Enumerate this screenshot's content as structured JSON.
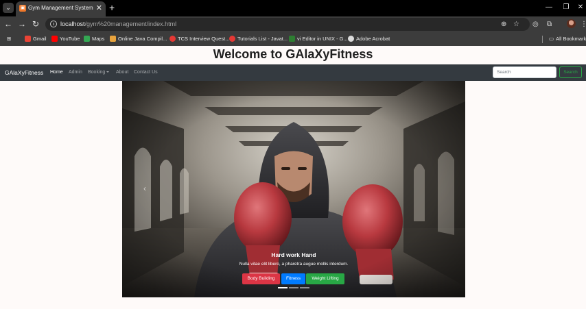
{
  "browser": {
    "tab_title": "Gym Management System",
    "url_host": "localhost",
    "url_path": "/gym%20management/index.html",
    "bookmarks": [
      {
        "label": "Gmail",
        "color": "#ea4335"
      },
      {
        "label": "YouTube",
        "color": "#ff0000"
      },
      {
        "label": "Maps",
        "color": "#34a853"
      },
      {
        "label": "Online Java Compil...",
        "color": "#e8a33d"
      },
      {
        "label": "TCS Interview Quest...",
        "color": "#e53935"
      },
      {
        "label": "Tutorials List - Javat...",
        "color": "#e53935"
      },
      {
        "label": "vi Editor in UNIX - G...",
        "color": "#2e7d32"
      },
      {
        "label": "Adobe Acrobat",
        "color": "#dddddd"
      }
    ],
    "all_bookmarks": "All Bookmarks"
  },
  "page": {
    "heading": "Welcome to GAlaXyFitness"
  },
  "navbar": {
    "brand": "GAlaXyFitness",
    "links": [
      "Home",
      "Admin",
      "Booking",
      "About",
      "Contact Us"
    ],
    "active_link": "Home",
    "search_placeholder": "Search",
    "search_button": "Search"
  },
  "carousel": {
    "caption_title": "Hard work Hand",
    "caption_text": "Nulla vitae elit libero, a pharetra augue mollis interdum.",
    "buttons": [
      "Body Building",
      "Fitness",
      "Weight Lifting"
    ],
    "button_colors": [
      "#dc3545",
      "#007bff",
      "#28a745"
    ],
    "slide_count": 3,
    "active_slide": 1
  }
}
